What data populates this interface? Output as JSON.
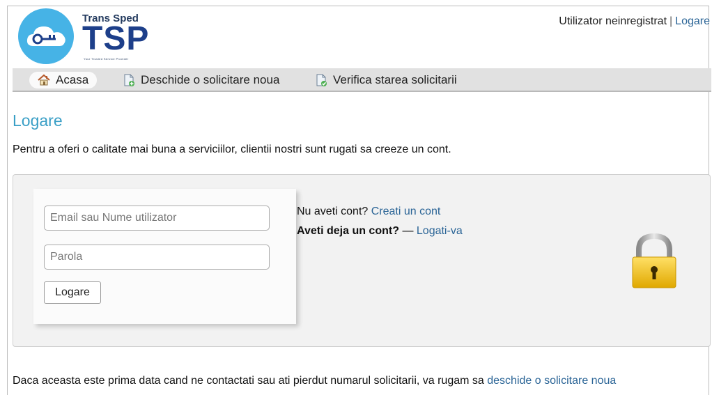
{
  "brand": {
    "name": "Trans Sped",
    "abbr": "TSP",
    "tagline": "Your Trusted Service Provider"
  },
  "userbar": {
    "status": "Utilizator neinregistrat",
    "separator": "|",
    "login_link": "Logare"
  },
  "nav": {
    "items": [
      {
        "label": "Acasa",
        "icon": "home-icon"
      },
      {
        "label": "Deschide o solicitare noua",
        "icon": "new-ticket-icon"
      },
      {
        "label": "Verifica starea solicitarii",
        "icon": "check-status-icon"
      }
    ]
  },
  "page": {
    "title": "Logare",
    "intro": "Pentru a oferi o calitate mai buna a serviciilor, clientii nostri sunt rugati sa creeze un cont."
  },
  "login": {
    "email_placeholder": "Email sau Nume utilizator",
    "password_placeholder": "Parola",
    "submit_label": "Logare"
  },
  "info": {
    "no_account_text": "Nu aveti cont?",
    "create_link": "Creati un cont",
    "have_account_text": "Aveti deja un cont?",
    "dash": "—",
    "login_link": "Logati-va"
  },
  "footer": {
    "text": "Daca aceasta este prima data cand ne contactati sau ati pierdut numarul solicitarii, va rugam sa",
    "link": "deschide o solicitare noua"
  },
  "colors": {
    "accent": "#3a9fc6",
    "link": "#2a6496",
    "logo_blue": "#46b3e6",
    "lock_gold": "#f5c518"
  }
}
